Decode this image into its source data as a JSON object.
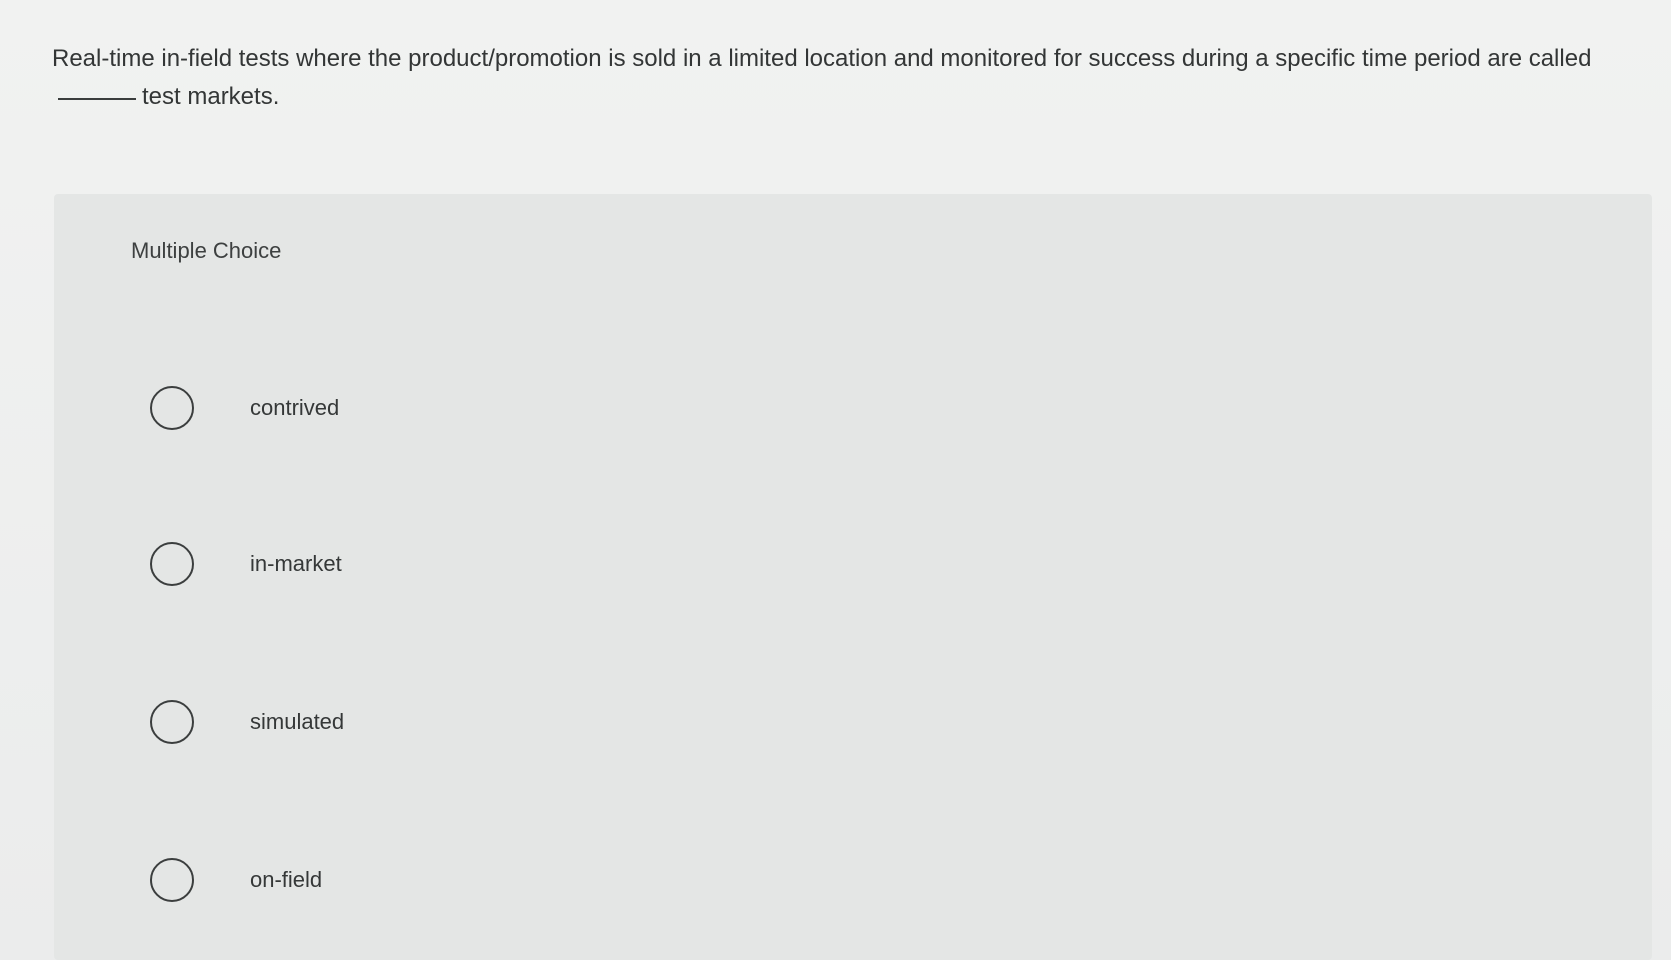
{
  "question": {
    "text_before": "Real-time in-field tests where the product/promotion is sold in a limited location and monitored for success during a specific time period are called",
    "text_after": "test markets."
  },
  "section_label": "Multiple Choice",
  "options": [
    {
      "label": "contrived"
    },
    {
      "label": "in-market"
    },
    {
      "label": "simulated"
    },
    {
      "label": "on-field"
    }
  ]
}
